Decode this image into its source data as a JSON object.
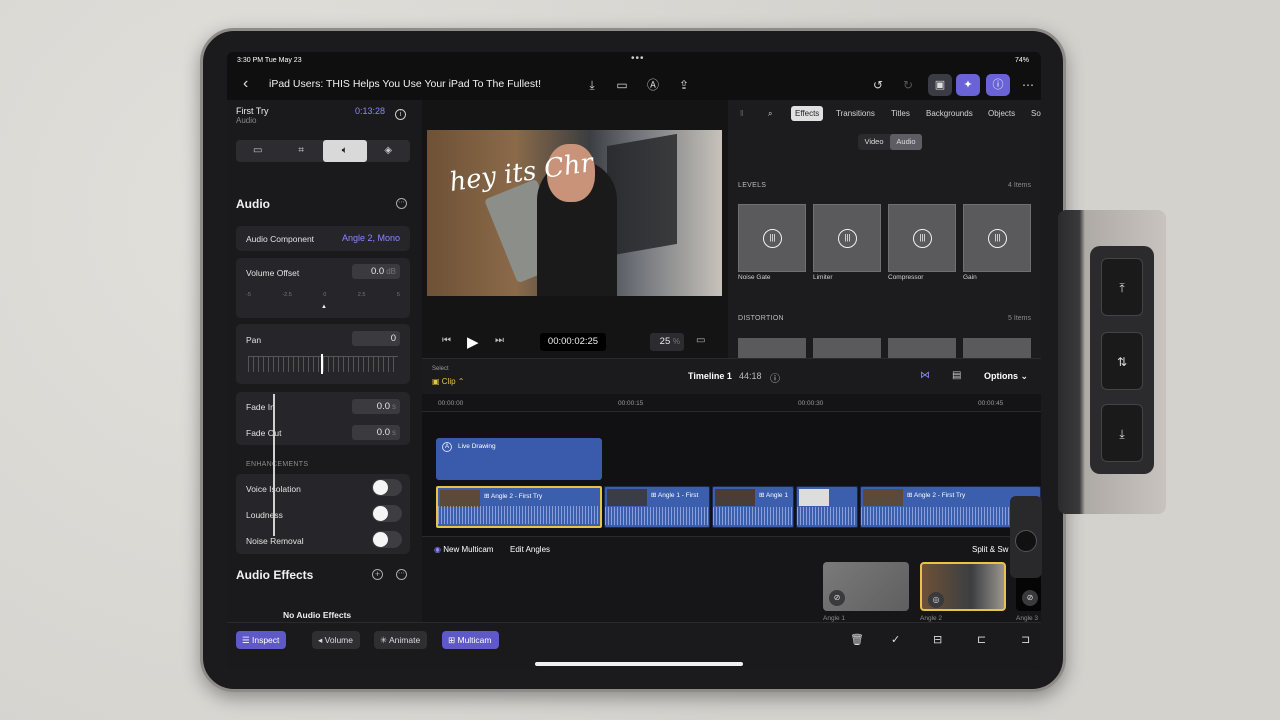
{
  "status": {
    "time": "3:30 PM  Tue May 23",
    "battery": "74%"
  },
  "header": {
    "title": "iPad Users: THIS Helps You Use Your iPad To The Fullest!"
  },
  "inspector": {
    "clip_name": "First Try",
    "clip_type": "Audio",
    "timecode": "0:13:28",
    "section_title": "Audio",
    "component_label": "Audio Component",
    "component_value": "Angle 2, Mono",
    "volume_offset_label": "Volume Offset",
    "volume_offset_value": "0.0",
    "volume_unit": "dB",
    "ruler_labels": [
      "-5",
      "-2.5",
      "0",
      "2.5",
      "5"
    ],
    "pan_label": "Pan",
    "pan_value": "0",
    "fade_in_label": "Fade In",
    "fade_in_value": "0.0",
    "fade_out_label": "Fade Out",
    "fade_out_value": "0.0",
    "seconds_unit": "s",
    "enhancements_label": "ENHANCEMENTS",
    "voice_isolation": "Voice Isolation",
    "loudness": "Loudness",
    "noise_removal": "Noise Removal",
    "audio_effects_title": "Audio Effects",
    "no_effects": "No Audio Effects"
  },
  "viewer": {
    "timecode": "00:00:02:25",
    "zoom": "25",
    "zoom_unit": "%",
    "overlay_text": "hey its Chr"
  },
  "browser": {
    "tabs": [
      "Effects",
      "Transitions",
      "Titles",
      "Backgrounds",
      "Objects",
      "So"
    ],
    "active_tab": "Effects",
    "video_label": "Video",
    "audio_label": "Audio",
    "levels_title": "LEVELS",
    "levels_count": "4 Items",
    "level_items": [
      "Noise Gate",
      "Limiter",
      "Compressor",
      "Gain"
    ],
    "distortion_title": "DISTORTION",
    "distortion_count": "5 Items"
  },
  "timeline": {
    "select_label": "Select",
    "clip_label": "Clip",
    "name": "Timeline 1",
    "duration": "44:18",
    "options": "Options",
    "ruler": [
      "00:00:00",
      "00:00:15",
      "00:00:30",
      "00:00:45"
    ],
    "live_drawing": "Live Drawing",
    "clips": [
      "Angle 2 - First Try",
      "Angle 1 - First",
      "Angle 1",
      "Angle 2 - First Try"
    ]
  },
  "multicam": {
    "new_multicam": "New Multicam",
    "edit_angles": "Edit Angles",
    "split": "Split & Sw",
    "angles": [
      "Angle 1",
      "Angle 2",
      "Angle 3"
    ]
  },
  "bottom": {
    "inspect": "Inspect",
    "volume": "Volume",
    "animate": "Animate",
    "multicam": "Multicam"
  },
  "colors": {
    "accent": "#6a63d7",
    "selection": "#e8c24a",
    "clip_blue": "#3b5ead"
  }
}
